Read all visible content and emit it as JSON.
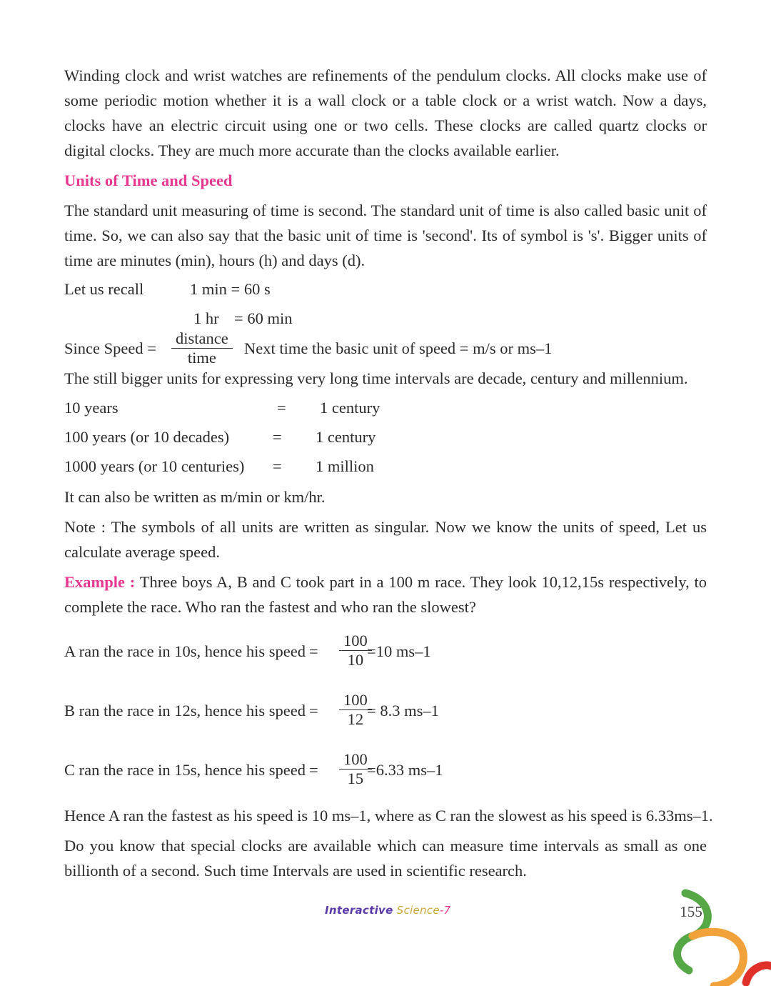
{
  "paragraphs": {
    "intro": "Winding clock and wrist watches are refinements of the pendulum clocks. All clocks make use of some periodic motion whether it is a wall clock or a table clock or a wrist watch. Now a days, clocks have an electric circuit using one or two cells. These clocks are called quartz clocks or digital clocks. They are much more accurate than the clocks available earlier.",
    "heading": "Units of Time and Speed",
    "units": "The standard unit measuring of time is second. The standard unit of time is also called basic unit of time. So, we can also say that the basic unit of time is 'second'. Its of symbol is 's'. Bigger units of time are minutes (min), hours (h) and days (d).",
    "still_bigger": "The still bigger units for expressing very long time intervals are decade, century and millennium.",
    "also_written": "It can also be written as m/min or km/hr.",
    "note": "Note : The symbols of all units are written as singular. Now we know the units of speed, Let us calculate average speed.",
    "example_label": "Example :",
    "example": "Three boys A, B and C took part in a 100 m race. They look 10,12,15s respectively, to complete the race. Who ran the fastest and who ran the slowest?",
    "conclusion": "Hence A ran the fastest as his speed is 10 ms–1, where as C ran the slowest as his speed is 6.33ms–1.",
    "closing": "Do you know that special clocks are available which can measure time intervals as small as one billionth of a second. Such time Intervals are used in scientific research."
  },
  "recall": {
    "label": "Let us recall",
    "row1": "1 min = 60 s",
    "row2_left": "1 hr",
    "row2_right": "= 60 min"
  },
  "speed_formula": {
    "label": "Since Speed =",
    "numerator": "distance",
    "denominator": "time",
    "suffix": "Next time the basic unit of speed = m/s or ms–1"
  },
  "conversions": [
    {
      "left": "10 years",
      "eq": "=",
      "right": "1 century"
    },
    {
      "left": "100 years (or 10 decades)",
      "eq": "=",
      "right": "1 century"
    },
    {
      "left": "1000 years (or 10 centuries)",
      "eq": "=",
      "right": "1 million"
    }
  ],
  "calculations": [
    {
      "text": "A ran the race in 10s, hence his speed",
      "eq": "=",
      "num": "100",
      "den": "10",
      "result": "=10 ms–1"
    },
    {
      "text": "B ran the race in 12s, hence his speed",
      "eq": "=",
      "num": "100",
      "den": "12",
      "result": "= 8.3 ms–1"
    },
    {
      "text": "C ran the race in 15s, hence his speed",
      "eq": "=",
      "num": "100",
      "den": "15",
      "result": "=6.33 ms–1"
    }
  ],
  "footer": {
    "brand_a": "Interactive",
    "brand_b": " Science",
    "brand_c": "-7",
    "page_number": "155"
  },
  "colors": {
    "heading": "#e8378f",
    "decor_green": "#55a845",
    "decor_orange": "#f2a23a",
    "decor_red": "#e0302a"
  }
}
